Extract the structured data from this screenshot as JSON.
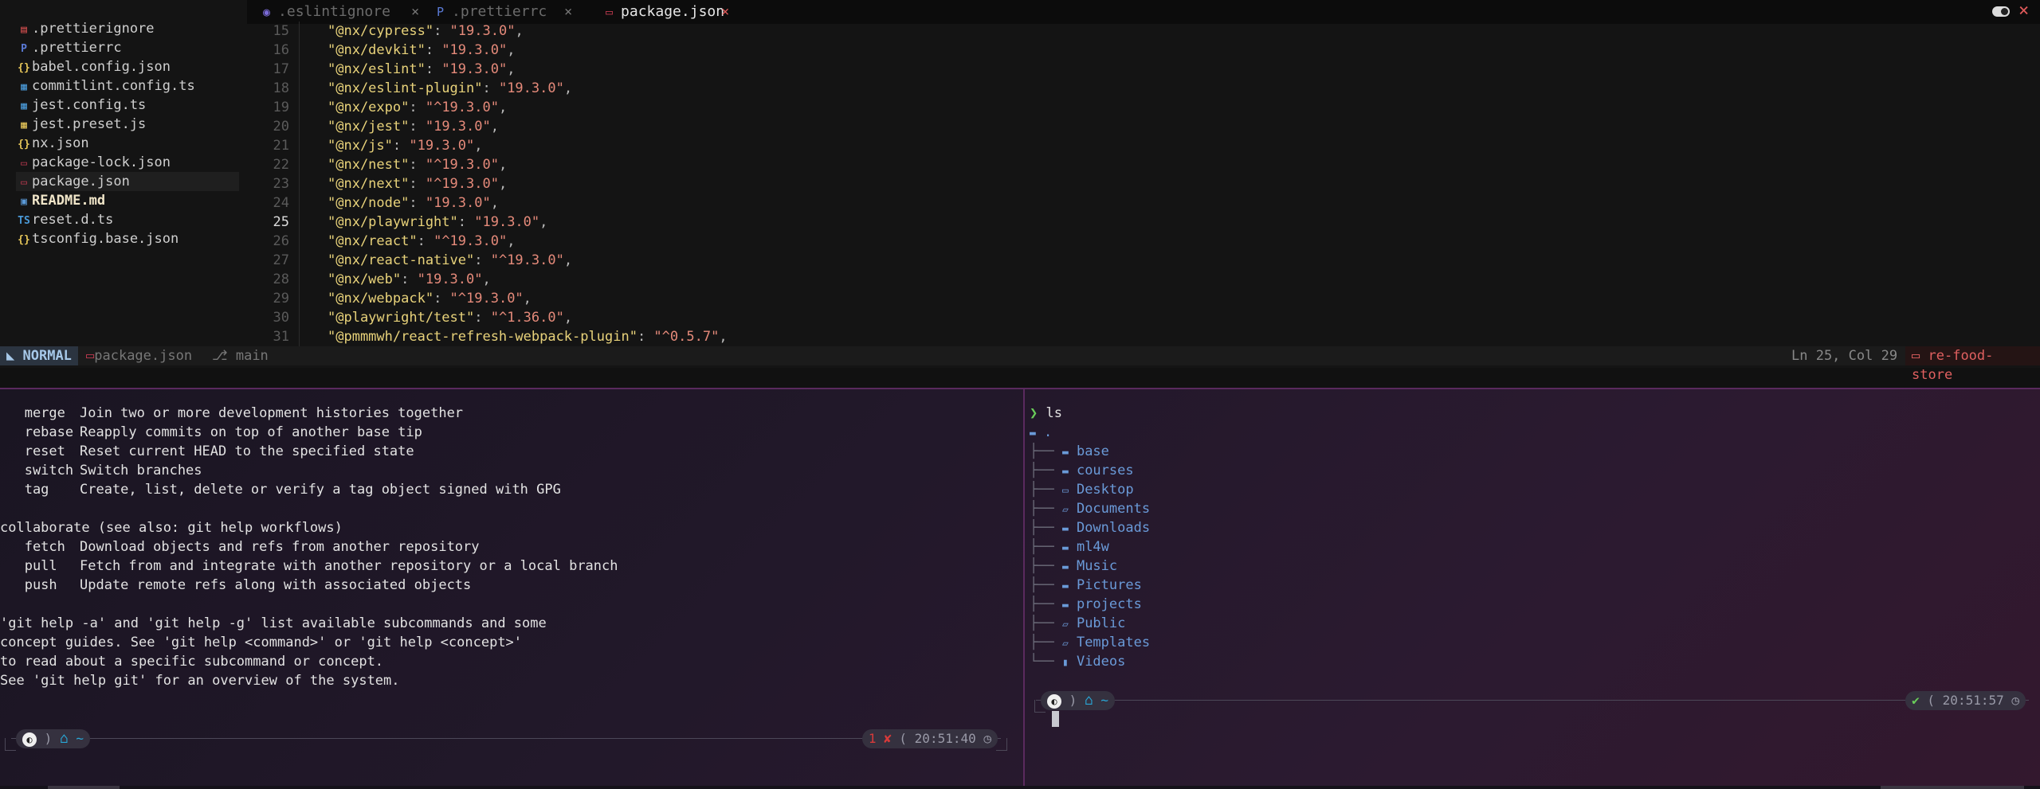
{
  "tabs": [
    {
      "label": ".eslintignore",
      "icon": "gear-icon",
      "icon_glyph": "◉",
      "icon_color": "#7b6bd8",
      "active": false
    },
    {
      "label": ".prettierrc",
      "icon": "prettier-icon",
      "icon_glyph": "P",
      "icon_color": "#5b7bd8",
      "active": false
    },
    {
      "label": "package.json",
      "icon": "npm-icon",
      "icon_glyph": "▭",
      "icon_color": "#c03a50",
      "active": true
    }
  ],
  "tab_close_glyph": "×",
  "files": [
    {
      "label": ".prettierignore",
      "icon_glyph": "▤",
      "icon_color": "#d85050"
    },
    {
      "label": ".prettierrc",
      "icon_glyph": "P",
      "icon_color": "#5b7bd8"
    },
    {
      "label": "babel.config.json",
      "icon_glyph": "{}",
      "icon_color": "#e8c85a"
    },
    {
      "label": "commitlint.config.ts",
      "icon_glyph": "▦",
      "icon_color": "#4a9ad8"
    },
    {
      "label": "jest.config.ts",
      "icon_glyph": "▦",
      "icon_color": "#4a9ad8"
    },
    {
      "label": "jest.preset.js",
      "icon_glyph": "▦",
      "icon_color": "#e8c85a"
    },
    {
      "label": "nx.json",
      "icon_glyph": "{}",
      "icon_color": "#e8c85a"
    },
    {
      "label": "package-lock.json",
      "icon_glyph": "▭",
      "icon_color": "#c03a50"
    },
    {
      "label": "package.json",
      "icon_glyph": "▭",
      "icon_color": "#c03a50",
      "selected": true
    },
    {
      "label": "README.md",
      "icon_glyph": "▣",
      "icon_color": "#5b9ad8",
      "bold": true
    },
    {
      "label": "reset.d.ts",
      "icon_glyph": "TS",
      "icon_color": "#4a9ad8"
    },
    {
      "label": "tsconfig.base.json",
      "icon_glyph": "{}",
      "icon_color": "#e8c85a"
    }
  ],
  "code_lines": [
    {
      "n": "15",
      "key": "\"@nx/cypress\"",
      "val": "\"19.3.0\""
    },
    {
      "n": "16",
      "key": "\"@nx/devkit\"",
      "val": "\"19.3.0\""
    },
    {
      "n": "17",
      "key": "\"@nx/eslint\"",
      "val": "\"19.3.0\""
    },
    {
      "n": "18",
      "key": "\"@nx/eslint-plugin\"",
      "val": "\"19.3.0\""
    },
    {
      "n": "19",
      "key": "\"@nx/expo\"",
      "val": "\"^19.3.0\""
    },
    {
      "n": "20",
      "key": "\"@nx/jest\"",
      "val": "\"19.3.0\""
    },
    {
      "n": "21",
      "key": "\"@nx/js\"",
      "val": "\"19.3.0\""
    },
    {
      "n": "22",
      "key": "\"@nx/nest\"",
      "val": "\"^19.3.0\""
    },
    {
      "n": "23",
      "key": "\"@nx/next\"",
      "val": "\"^19.3.0\""
    },
    {
      "n": "24",
      "key": "\"@nx/node\"",
      "val": "\"19.3.0\""
    },
    {
      "n": "25",
      "key": "\"@nx/playwright\"",
      "val": "\"19.3.0\"",
      "current": true
    },
    {
      "n": "26",
      "key": "\"@nx/react\"",
      "val": "\"^19.3.0\""
    },
    {
      "n": "27",
      "key": "\"@nx/react-native\"",
      "val": "\"^19.3.0\""
    },
    {
      "n": "28",
      "key": "\"@nx/web\"",
      "val": "\"19.3.0\""
    },
    {
      "n": "29",
      "key": "\"@nx/webpack\"",
      "val": "\"^19.3.0\""
    },
    {
      "n": "30",
      "key": "\"@playwright/test\"",
      "val": "\"^1.36.0\""
    },
    {
      "n": "31",
      "key": "\"@pmmmwh/react-refresh-webpack-plugin\"",
      "val": "\"^0.5.7\""
    }
  ],
  "statusline": {
    "mode": "NORMAL",
    "mode_icon": "◣",
    "file": "package.json",
    "file_icon": "▭",
    "branch": "main",
    "branch_icon": "⎇",
    "position": "Ln 25, Col 29",
    "project": "re-food-store",
    "project_icon": "▭"
  },
  "left_terminal": {
    "lines": [
      {
        "cmd": "   merge",
        "desc": "Join two or more development histories together"
      },
      {
        "cmd": "   rebase",
        "desc": "Reapply commits on top of another base tip"
      },
      {
        "cmd": "   reset",
        "desc": "Reset current HEAD to the specified state"
      },
      {
        "cmd": "   switch",
        "desc": "Switch branches"
      },
      {
        "cmd": "   tag",
        "desc": "Create, list, delete or verify a tag object signed with GPG"
      },
      {
        "cmd": "",
        "desc": ""
      },
      {
        "cmd": "",
        "desc": "collaborate (see also: git help workflows)",
        "plain": true
      },
      {
        "cmd": "   fetch",
        "desc": "Download objects and refs from another repository"
      },
      {
        "cmd": "   pull",
        "desc": "Fetch from and integrate with another repository or a local branch"
      },
      {
        "cmd": "   push",
        "desc": "Update remote refs along with associated objects"
      },
      {
        "cmd": "",
        "desc": ""
      },
      {
        "cmd": "",
        "desc": "'git help -a' and 'git help -g' list available subcommands and some",
        "plain": true
      },
      {
        "cmd": "",
        "desc": "concept guides. See 'git help <command>' or 'git help <concept>'",
        "plain": true
      },
      {
        "cmd": "",
        "desc": "to read about a specific subcommand or concept.",
        "plain": true
      },
      {
        "cmd": "",
        "desc": "See 'git help git' for an overview of the system.",
        "plain": true
      }
    ],
    "prompt": {
      "os_glyph": "◐",
      "sep": ")",
      "home_glyph": "⌂",
      "dir": "~",
      "status": "1 ✘",
      "time": "20:51:40",
      "clock_glyph": "◷"
    }
  },
  "right_terminal": {
    "command_prompt": "❯",
    "command": "ls",
    "root": ".",
    "entries": [
      {
        "name": "base",
        "icon": "folder-icon",
        "glyph": "▬"
      },
      {
        "name": "courses",
        "icon": "folder-icon",
        "glyph": "▬"
      },
      {
        "name": "Desktop",
        "icon": "desktop-icon",
        "glyph": "▭"
      },
      {
        "name": "Documents",
        "icon": "folder-open-icon",
        "glyph": "▱"
      },
      {
        "name": "Downloads",
        "icon": "folder-download-icon",
        "glyph": "▬"
      },
      {
        "name": "ml4w",
        "icon": "folder-icon",
        "glyph": "▬"
      },
      {
        "name": "Music",
        "icon": "folder-music-icon",
        "glyph": "▬"
      },
      {
        "name": "Pictures",
        "icon": "folder-image-icon",
        "glyph": "▬"
      },
      {
        "name": "projects",
        "icon": "folder-icon",
        "glyph": "▬"
      },
      {
        "name": "Public",
        "icon": "folder-open-icon",
        "glyph": "▱"
      },
      {
        "name": "Templates",
        "icon": "folder-open-icon",
        "glyph": "▱"
      },
      {
        "name": "Videos",
        "icon": "video-icon",
        "glyph": "▮"
      }
    ],
    "tree_mid": "├──",
    "tree_end": "└──",
    "prompt": {
      "os_glyph": "◐",
      "sep": ")",
      "home_glyph": "⌂",
      "dir": "~",
      "status": "✔",
      "time": "20:51:57",
      "clock_glyph": "◷"
    }
  }
}
